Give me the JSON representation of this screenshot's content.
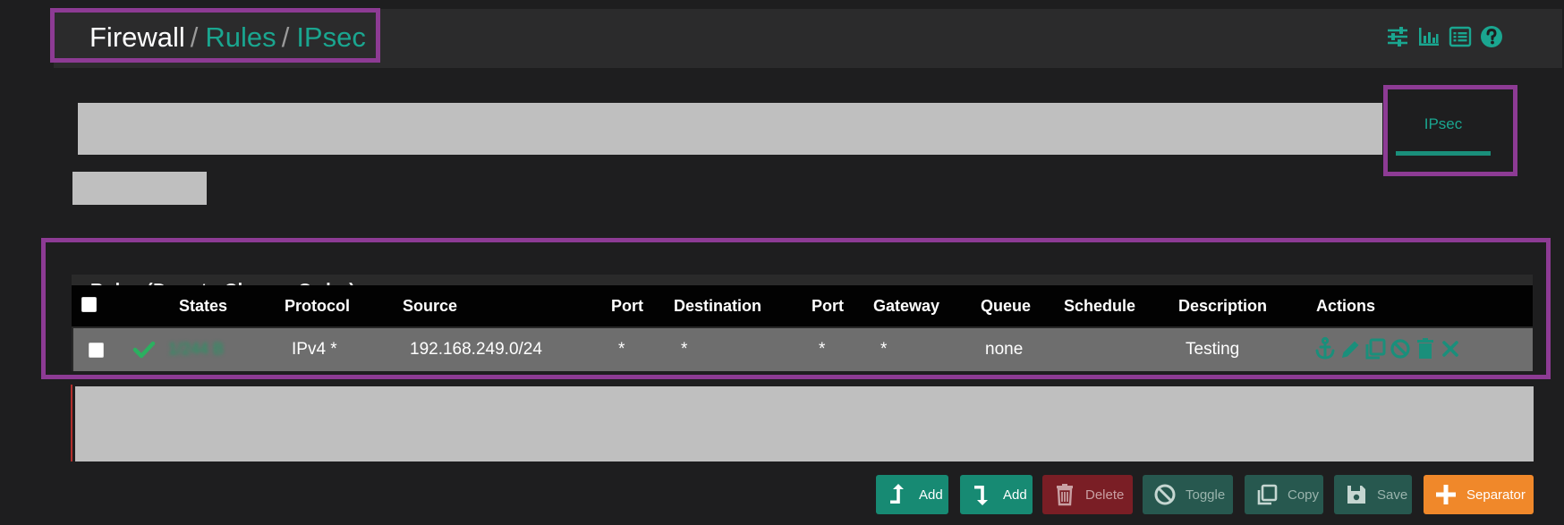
{
  "breadcrumb": {
    "root": "Firewall",
    "sep1": "/",
    "rules": "Rules",
    "sep2": "/",
    "current": "IPsec"
  },
  "header_icons": [
    "sliders-icon",
    "bar-chart-icon",
    "list-icon",
    "help-icon"
  ],
  "tabs": [
    {
      "label": "IPsec",
      "active": true
    }
  ],
  "rules_panel": {
    "title": "Rules (Drag to Change Order)",
    "columns": [
      "States",
      "Protocol",
      "Source",
      "Port",
      "Destination",
      "Port",
      "Gateway",
      "Queue",
      "Schedule",
      "Description",
      "Actions"
    ],
    "rows": [
      {
        "status_icon": "check-icon",
        "states": "1/244 B",
        "protocol": "IPv4 *",
        "source": "192.168.249.0/24",
        "source_port": "*",
        "destination": "*",
        "destination_port": "*",
        "gateway": "*",
        "queue": "none",
        "schedule": "",
        "description": "Testing",
        "actions": [
          "anchor-icon",
          "pencil-icon",
          "copy-icon",
          "disable-icon",
          "trash-icon",
          "delete-x-icon"
        ]
      }
    ]
  },
  "buttons": {
    "add_top": "Add",
    "add_bottom": "Add",
    "delete": "Delete",
    "toggle": "Toggle",
    "copy": "Copy",
    "save": "Save",
    "separator": "Separator"
  },
  "colors": {
    "accent": "#1aa690",
    "highlight_border": "#8d3b94",
    "danger": "#7a1e25",
    "warning": "#f0882a",
    "success": "#2bb060"
  }
}
